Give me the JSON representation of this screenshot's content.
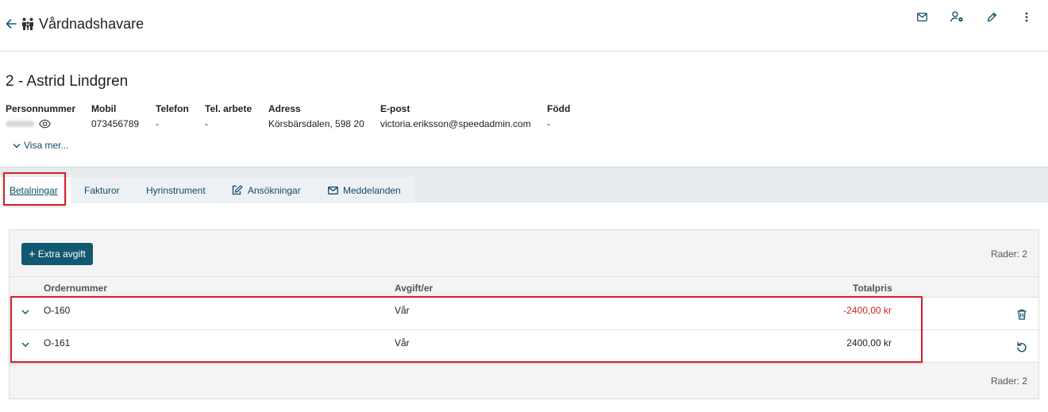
{
  "header": {
    "title": "Vårdnadshavare",
    "actions": [
      {
        "icon": "mail-icon"
      },
      {
        "icon": "user-settings-icon"
      },
      {
        "icon": "pencil-icon"
      },
      {
        "icon": "more-vertical-icon"
      }
    ]
  },
  "person": {
    "name": "2  - Astrid Lindgren",
    "fields": [
      {
        "label": "Personnummer",
        "value": ""
      },
      {
        "label": "Mobil",
        "value": "073456789"
      },
      {
        "label": "Telefon",
        "value": "-"
      },
      {
        "label": "Tel. arbete",
        "value": "-"
      },
      {
        "label": "Adress",
        "value": "Körsbärsdalen, 598 20"
      },
      {
        "label": "E-post",
        "value": "victoria.eriksson@speedadmin.com"
      },
      {
        "label": "Född",
        "value": "-"
      }
    ],
    "show_more": "Visa mer..."
  },
  "tabs": [
    {
      "label": "Betalningar",
      "active": true
    },
    {
      "label": "Fakturor"
    },
    {
      "label": "Hyrinstrument"
    },
    {
      "label": "Ansökningar",
      "icon": "edit-document-icon"
    },
    {
      "label": "Meddelanden",
      "icon": "mail-icon"
    }
  ],
  "payments": {
    "add_button": "Extra avgift",
    "row_count": "Rader: 2",
    "columns": [
      "Ordernummer",
      "Avgift/er",
      "Totalpris"
    ],
    "rows": [
      {
        "order": "O-160",
        "fee": "Vår",
        "total": "-2400,00 kr",
        "action_icon": "trash-icon"
      },
      {
        "order": "O-161",
        "fee": "Vår",
        "total": "2400,00 kr",
        "action_icon": "undo-icon"
      }
    ]
  },
  "colors": {
    "accent": "#105970",
    "link": "#0e4c65",
    "negative": "#c62828",
    "highlight": "#d0242b"
  }
}
